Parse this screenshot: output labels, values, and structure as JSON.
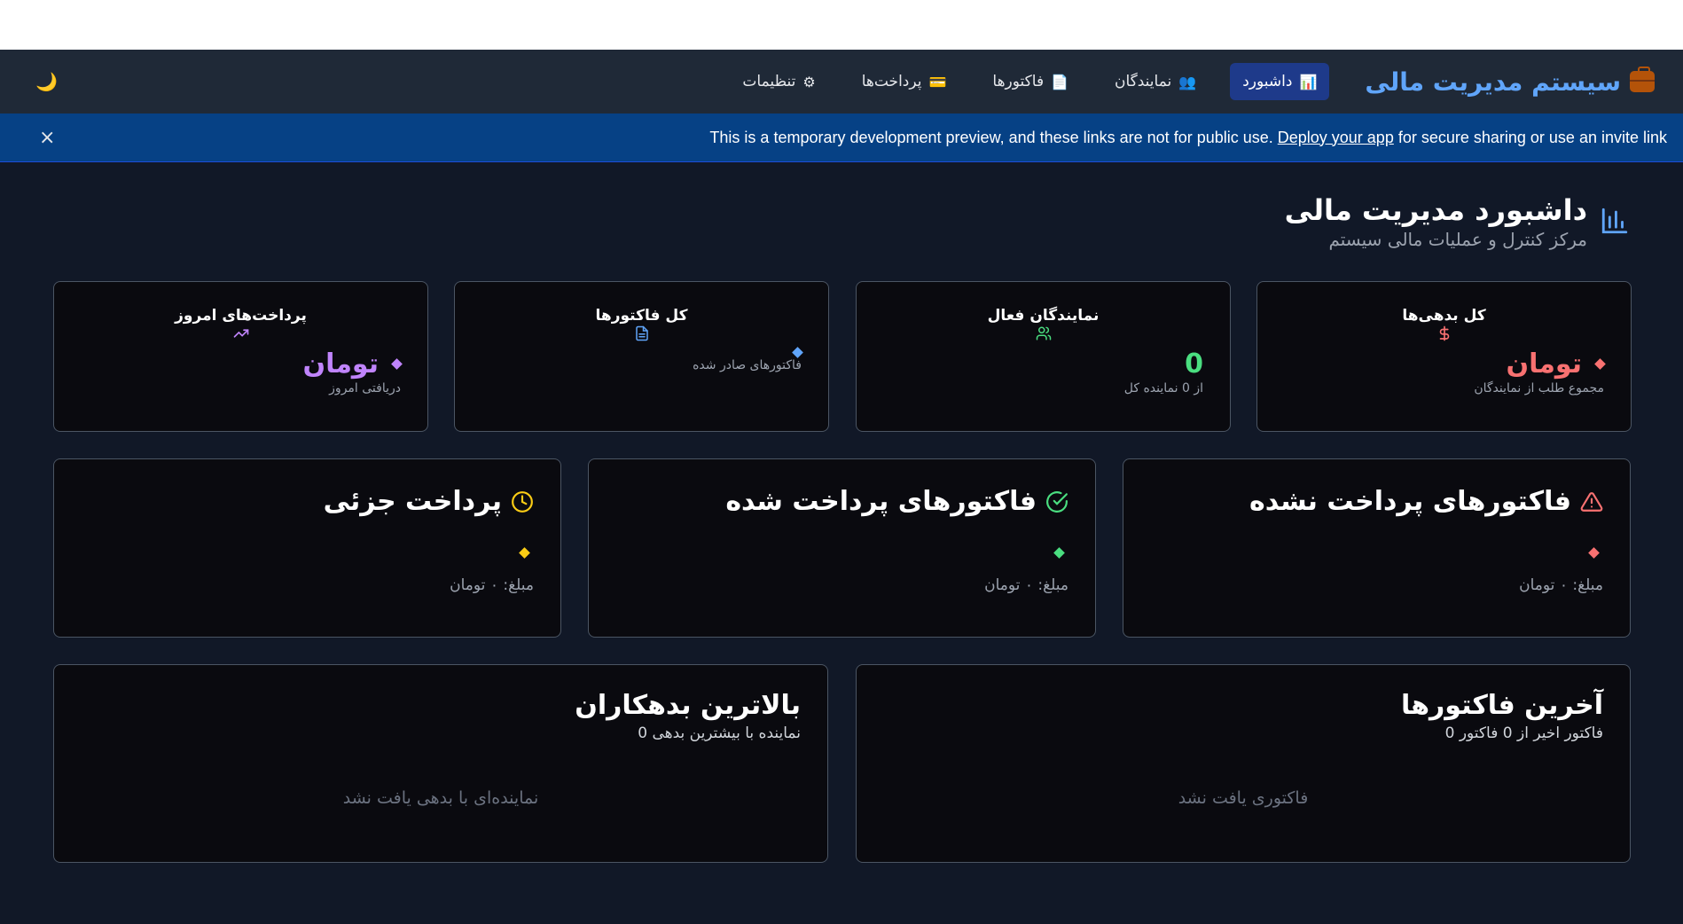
{
  "nav": {
    "brand": "سیستم مدیریت مالی",
    "items": [
      {
        "label": "داشبورد",
        "icon": "📊",
        "active": true
      },
      {
        "label": "نمایندگان",
        "icon": "👥",
        "active": false
      },
      {
        "label": "فاکتورها",
        "icon": "📄",
        "active": false
      },
      {
        "label": "پرداخت‌ها",
        "icon": "💳",
        "active": false
      },
      {
        "label": "تنظیمات",
        "icon": "⚙",
        "active": false
      }
    ],
    "theme_icon": "🌙"
  },
  "banner": {
    "text_before": "This is a temporary development preview, and these links are not for public use. ",
    "link": "Deploy your app",
    "text_after": " for secure sharing or use an invite link",
    "close": "×"
  },
  "header": {
    "title": "داشبورد مدیریت مالی",
    "subtitle": "مرکز کنترل و عملیات مالی سیستم",
    "icon": "bar-chart-icon"
  },
  "stats": [
    {
      "title": "کل بدهی‌ها",
      "icon": "dollar-icon",
      "value": "تومان",
      "desc": "مجموع طلب از نمایندگان",
      "color": "#f87171"
    },
    {
      "title": "نمایندگان فعال",
      "icon": "users-icon",
      "value": "0",
      "desc": "از 0 نماینده کل",
      "color": "#4ade80"
    },
    {
      "title": "کل فاکتورها",
      "icon": "file-icon",
      "value": "",
      "desc": "فاکتورهای صادر شده",
      "color": "#60a5fa"
    },
    {
      "title": "پرداخت‌های امروز",
      "icon": "trending-up-icon",
      "value": "تومان",
      "desc": "دریافتی امروز",
      "color": "#c084fc"
    }
  ],
  "status_cards": [
    {
      "title": "فاکتورهای پرداخت نشده",
      "icon": "alert-triangle-icon",
      "amount": "مبلغ: ۰ تومان",
      "color": "#f87171"
    },
    {
      "title": "فاکتورهای پرداخت شده",
      "icon": "check-circle-icon",
      "amount": "مبلغ: ۰ تومان",
      "color": "#4ade80"
    },
    {
      "title": "پرداخت جزئی",
      "icon": "clock-icon",
      "amount": "مبلغ: ۰ تومان",
      "color": "#facc15"
    }
  ],
  "recent_invoices": {
    "title": "آخرین فاکتورها",
    "subtitle": "0 فاکتور اخیر از 0 فاکتور",
    "empty": "فاکتوری یافت نشد"
  },
  "top_debtors": {
    "title": "بالاترین بدهکاران",
    "subtitle": "0 نماینده با بیشترین بدهی",
    "empty": "نماینده‌ای با بدهی یافت نشد"
  }
}
